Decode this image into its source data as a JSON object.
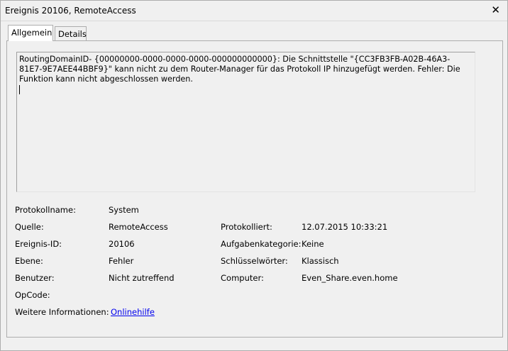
{
  "window": {
    "title": "Ereignis 20106, RemoteAccess",
    "close_icon": "close-icon"
  },
  "tabs": [
    {
      "label": "Allgemein",
      "active": true
    },
    {
      "label": "Details",
      "active": false
    }
  ],
  "description": "RoutingDomainID- {00000000-0000-0000-0000-000000000000}: Die Schnittstelle \"{CC3FB3FB-A02B-46A3-81E7-9E7AEE44BBF9}\" kann nicht zu dem Router-Manager für das Protokoll IP hinzugefügt werden. Fehler: Die Funktion kann nicht abgeschlossen werden.",
  "fields": {
    "protokollname": {
      "label": "Protokollname:",
      "value": "System"
    },
    "quelle": {
      "label": "Quelle:",
      "value": "RemoteAccess"
    },
    "protokolliert": {
      "label": "Protokolliert:",
      "value": "12.07.2015 10:33:21"
    },
    "ereignis_id": {
      "label": "Ereignis-ID:",
      "value": "20106"
    },
    "aufgabenkategorie": {
      "label": "Aufgabenkategorie:",
      "value": "Keine"
    },
    "ebene": {
      "label": "Ebene:",
      "value": "Fehler"
    },
    "schluesselwoerter": {
      "label": "Schlüsselwörter:",
      "value": "Klassisch"
    },
    "benutzer": {
      "label": "Benutzer:",
      "value": "Nicht zutreffend"
    },
    "computer": {
      "label": "Computer:",
      "value": "Even_Share.even.home"
    },
    "opcode": {
      "label": "OpCode:",
      "value": ""
    },
    "weitere_informationen": {
      "label": "Weitere Informationen:",
      "link": "Onlinehilfe"
    }
  }
}
